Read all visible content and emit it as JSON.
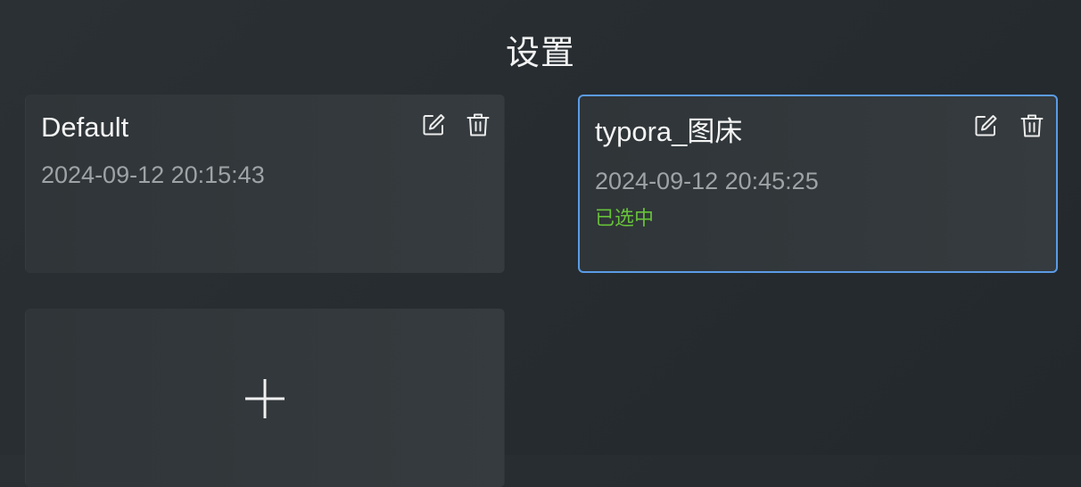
{
  "page": {
    "title": "设置"
  },
  "configs": [
    {
      "name": "Default",
      "date": "2024-09-12 20:15:43",
      "status": "",
      "selected": false
    },
    {
      "name": "typora_图床",
      "date": "2024-09-12 20:45:25",
      "status": "已选中",
      "selected": true
    }
  ],
  "icons": {
    "edit": "edit-icon",
    "delete": "trash-icon",
    "add": "plus-icon"
  },
  "colors": {
    "background": "#262c30",
    "card": "#32383b",
    "selected_border": "#5b9be6",
    "status_green": "#67c23a",
    "date_gray": "#9ea3a6"
  }
}
